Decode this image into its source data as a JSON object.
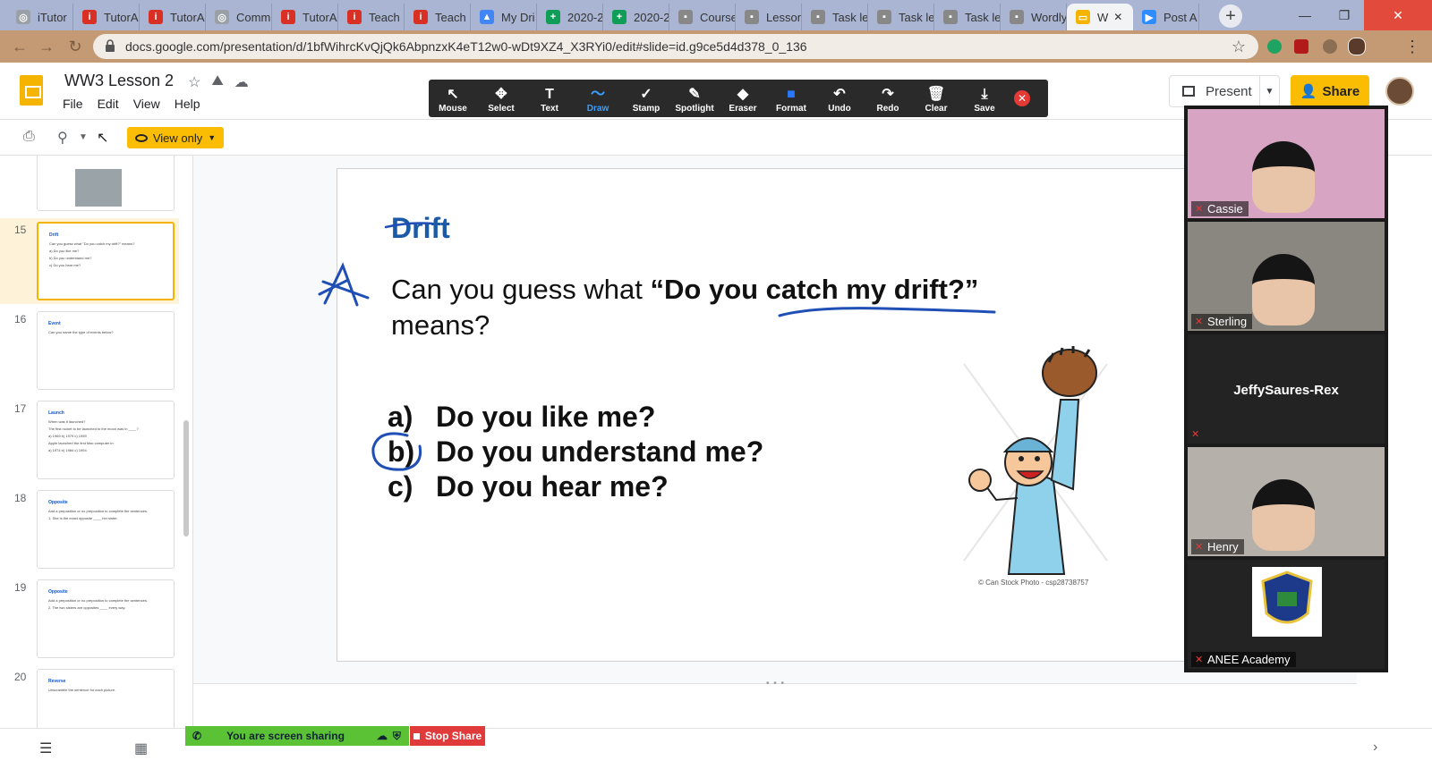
{
  "browser": {
    "tabs": [
      {
        "label": "iTutor",
        "color": "#9aa0a6",
        "glyph": "◎"
      },
      {
        "label": "TutorA",
        "color": "#d93025",
        "glyph": "i"
      },
      {
        "label": "TutorA",
        "color": "#d93025",
        "glyph": "i"
      },
      {
        "label": "Comm",
        "color": "#9aa0a6",
        "glyph": "◎"
      },
      {
        "label": "TutorA",
        "color": "#d93025",
        "glyph": "i"
      },
      {
        "label": "Teach",
        "color": "#d93025",
        "glyph": "i"
      },
      {
        "label": "Teach",
        "color": "#d93025",
        "glyph": "i"
      },
      {
        "label": "My Dri",
        "color": "#4285f4",
        "glyph": "▲"
      },
      {
        "label": "2020-2",
        "color": "#0f9d58",
        "glyph": "+"
      },
      {
        "label": "2020-2",
        "color": "#0f9d58",
        "glyph": "+"
      },
      {
        "label": "Course",
        "color": "#888888",
        "glyph": "▪"
      },
      {
        "label": "Lesson",
        "color": "#888888",
        "glyph": "▪"
      },
      {
        "label": "Task le",
        "color": "#888888",
        "glyph": "▪"
      },
      {
        "label": "Task le",
        "color": "#888888",
        "glyph": "▪"
      },
      {
        "label": "Task le",
        "color": "#888888",
        "glyph": "▪"
      },
      {
        "label": "Wordly",
        "color": "#888888",
        "glyph": "▪"
      },
      {
        "label": "W",
        "color": "#f4b400",
        "glyph": "▭"
      },
      {
        "label": "Post A",
        "color": "#2d8cff",
        "glyph": "▶"
      }
    ],
    "active_tab_index": 16,
    "url": "docs.google.com/presentation/d/1bfWihrcKvQjQk6AbpnzxK4eT12w0-wDt9XZ4_X3RYi0/edit#slide=id.g9ce5d4d378_0_136"
  },
  "docs": {
    "title": "WW3 Lesson 2",
    "menu": [
      "File",
      "Edit",
      "View",
      "Help"
    ],
    "present_label": "Present",
    "share_label": "Share",
    "view_only_label": "View only"
  },
  "annotation_toolbar": {
    "tools": [
      {
        "label": "Mouse",
        "icon": "↖"
      },
      {
        "label": "Select",
        "icon": "✥"
      },
      {
        "label": "Text",
        "icon": "T"
      },
      {
        "label": "Draw",
        "icon": "〜"
      },
      {
        "label": "Stamp",
        "icon": "✓"
      },
      {
        "label": "Spotlight",
        "icon": "✎"
      },
      {
        "label": "Eraser",
        "icon": "◆"
      },
      {
        "label": "Format",
        "icon": "■"
      },
      {
        "label": "Undo",
        "icon": "↶"
      },
      {
        "label": "Redo",
        "icon": "↷"
      },
      {
        "label": "Clear",
        "icon": "🗑"
      },
      {
        "label": "Save",
        "icon": "⤓"
      }
    ],
    "active_tool": "Draw"
  },
  "filmstrip": {
    "slides": [
      {
        "num": "",
        "title": "",
        "lines": []
      },
      {
        "num": "15",
        "title": "Drift",
        "lines": [
          "Can you guess what \"Do you catch my drift?\" means?",
          "a)  Do you like me?",
          "b)  Do you understand me?",
          "c)  Do you hear me?"
        ]
      },
      {
        "num": "16",
        "title": "Event",
        "lines": [
          "Can you name the type of events below?"
        ]
      },
      {
        "num": "17",
        "title": "Launch",
        "lines": [
          "When was it launched?",
          "The first rocket to be launched to the moon was in ____?",
          "a) 1969   b) 1979   c) 1959",
          "Apple launched the first Mac computer in:",
          "a) 1974   b) 1984   c) 1994"
        ]
      },
      {
        "num": "18",
        "title": "Opposite",
        "lines": [
          "Add a preposition or no preposition to complete the sentences.",
          "1.  She is the exact opposite ____ her sister."
        ]
      },
      {
        "num": "19",
        "title": "Opposite",
        "lines": [
          "Add a preposition or no preposition to complete the sentences.",
          "2.  The two sisters are opposites ____ every way."
        ]
      },
      {
        "num": "20",
        "title": "Reverse",
        "lines": [
          "Unscramble the sentence for each picture."
        ]
      }
    ],
    "selected": "15"
  },
  "slide": {
    "title": "Drift",
    "question_prefix": "Can you guess what ",
    "question_bold": "“Do you catch my drift?”",
    "question_suffix": "means?",
    "options": [
      {
        "letter": "a)",
        "text": "Do you like me?"
      },
      {
        "letter": "b)",
        "text": "Do you understand me?"
      },
      {
        "letter": "c)",
        "text": "Do you hear me?"
      }
    ],
    "copyright": "© Can Stock Photo - csp28738757"
  },
  "zoom": {
    "participants": [
      {
        "name": "Cassie",
        "video": true,
        "bg": "#d7a4c4",
        "muted": true
      },
      {
        "name": "Sterling",
        "video": true,
        "bg": "#8a8780",
        "muted": true
      },
      {
        "name": "JeffySaures-Rex",
        "video": false,
        "bg": "#232323",
        "muted": true
      },
      {
        "name": "Henry",
        "video": true,
        "bg": "#b5b0aa",
        "muted": true
      },
      {
        "name": "ANEE Academy",
        "video": false,
        "bg": "#232323",
        "muted": true,
        "logo": true
      }
    ]
  },
  "sharing_bar": {
    "status": "You are screen sharing",
    "stop_label": "Stop Share"
  }
}
